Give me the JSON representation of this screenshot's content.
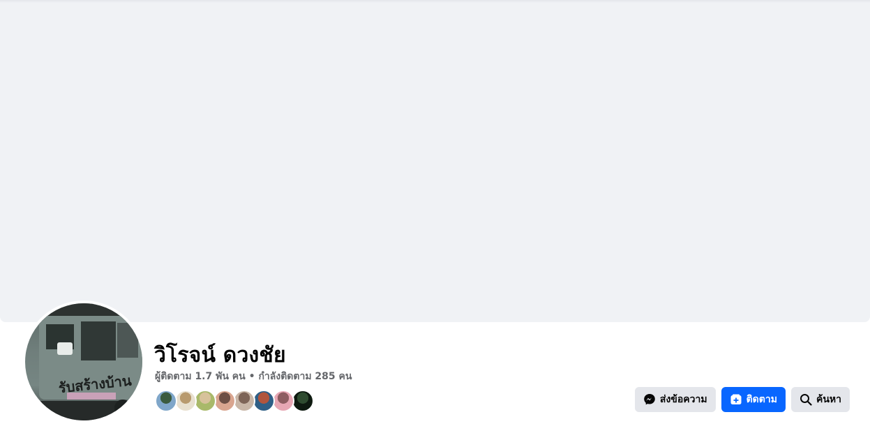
{
  "profile": {
    "name": "วิโรจน์ ดวงชัย",
    "followers_text": "ผู้ติดตาม 1.7 พัน คน",
    "separator": " • ",
    "following_text": "กำลังติดตาม 285 คน",
    "avatar_truck_text": "รับสร้างบ้าน"
  },
  "follower_avatars": [
    {
      "name": "follower-avatar-1",
      "colors": [
        "#7fa6c9",
        "#3b5b3e"
      ]
    },
    {
      "name": "follower-avatar-2",
      "colors": [
        "#e8e0cf",
        "#b89a6e"
      ]
    },
    {
      "name": "follower-avatar-3",
      "colors": [
        "#a9b96a",
        "#d7c29b"
      ]
    },
    {
      "name": "follower-avatar-4",
      "colors": [
        "#d9a58f",
        "#6d4f45"
      ]
    },
    {
      "name": "follower-avatar-5",
      "colors": [
        "#c8b6a7",
        "#7d6457"
      ]
    },
    {
      "name": "follower-avatar-6",
      "colors": [
        "#2f5f86",
        "#b1553d"
      ]
    },
    {
      "name": "follower-avatar-7",
      "colors": [
        "#e7a7b4",
        "#8d5d61"
      ]
    },
    {
      "name": "follower-avatar-8",
      "colors": [
        "#0e1a10",
        "#2e4b2f"
      ]
    }
  ],
  "actions": {
    "message_label": "ส่งข้อความ",
    "follow_label": "ติดตาม",
    "search_label": "ค้นหา"
  },
  "colors": {
    "cover": "#f0f2f5",
    "primary": "#0866ff",
    "secondary_button": "#e4e6eb"
  },
  "icons": [
    "messenger-icon",
    "follow-icon",
    "search-icon"
  ]
}
